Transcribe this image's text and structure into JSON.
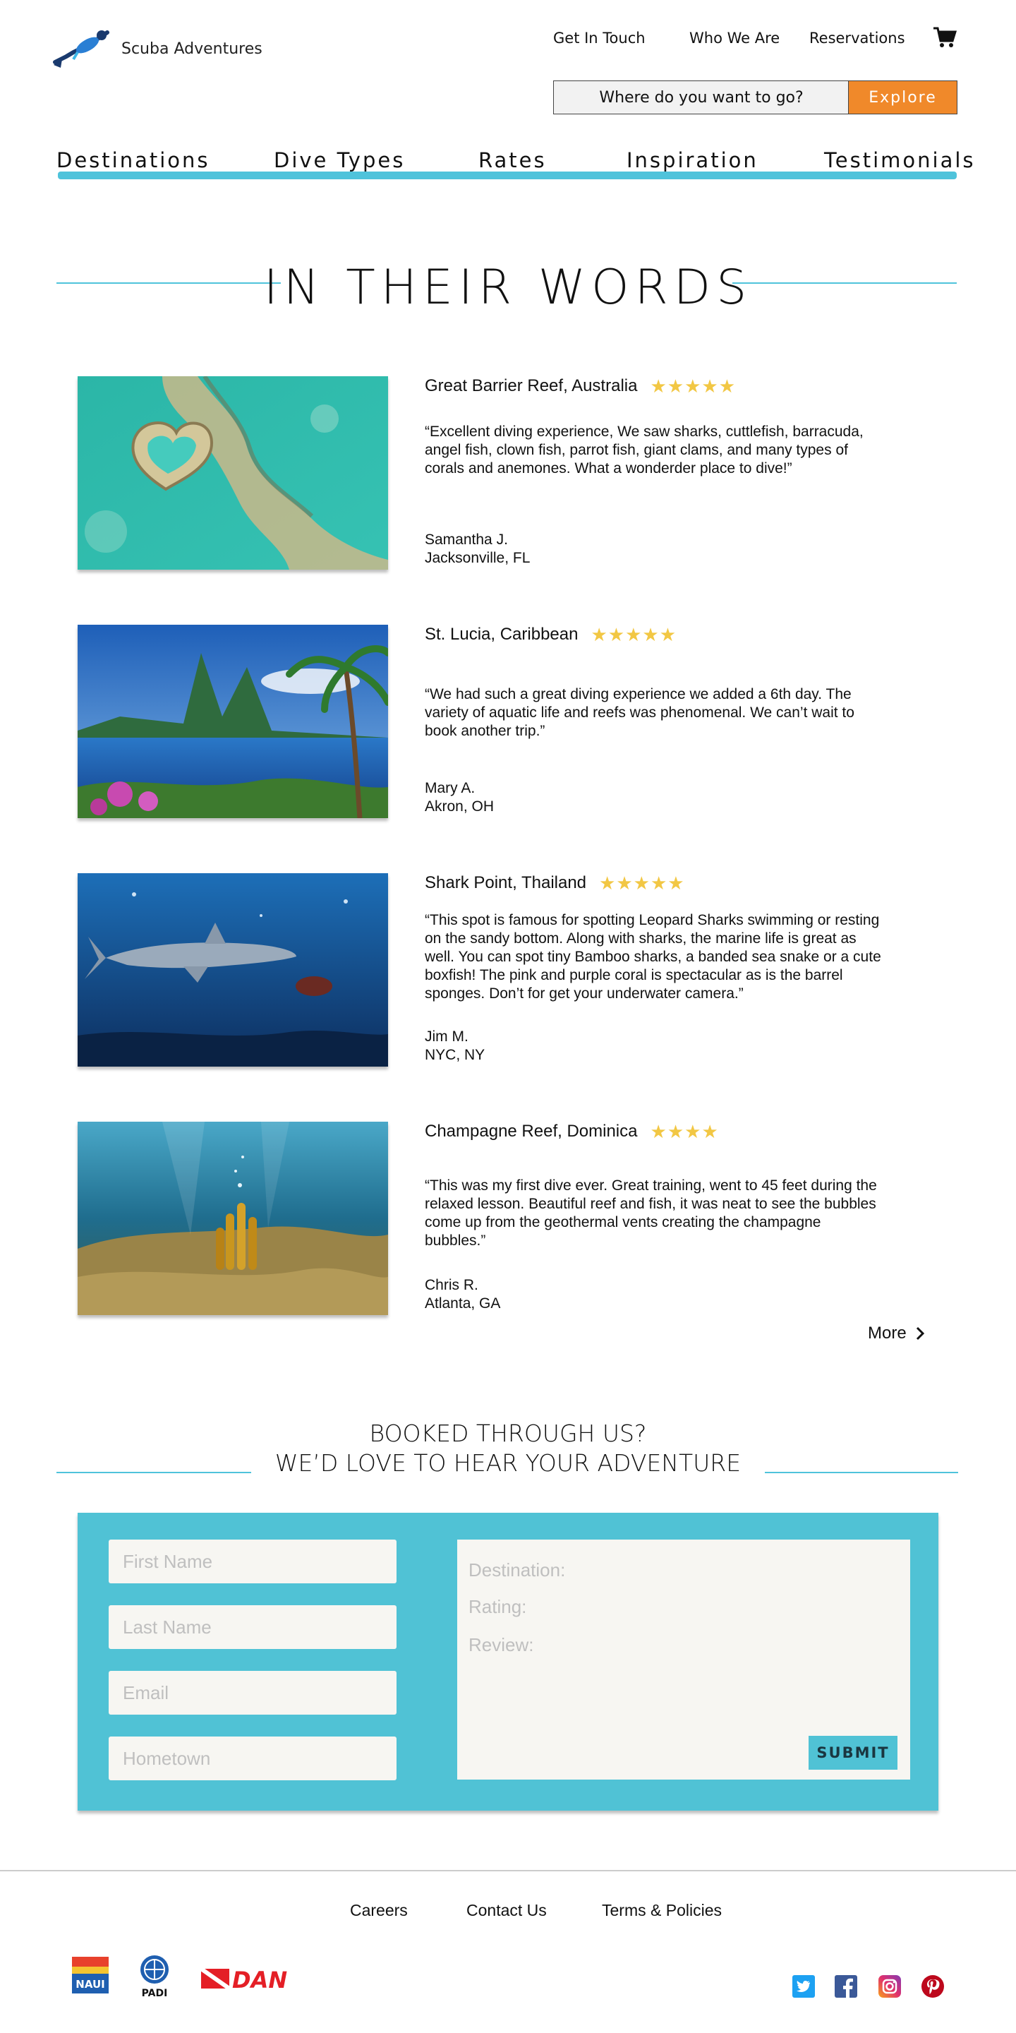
{
  "brand": {
    "name": "Scuba Adventures"
  },
  "topnav": [
    {
      "label": "Get In Touch"
    },
    {
      "label": "Who We Are"
    },
    {
      "label": "Reservations"
    }
  ],
  "search": {
    "placeholder": "Where do you want to go?",
    "button": "Explore"
  },
  "mainnav": [
    {
      "label": "Destinations"
    },
    {
      "label": "Dive Types"
    },
    {
      "label": "Rates"
    },
    {
      "label": "Inspiration"
    },
    {
      "label": "Testimonials"
    }
  ],
  "section_title": "IN THEIR WORDS",
  "testimonials": [
    {
      "title": "Great Barrier Reef, Australia",
      "rating": 5,
      "quote": "“Excellent diving experience, We saw sharks, cuttlefish, barracuda, angel fish, clown fish, parrot fish, giant clams, and many types of corals and anemones. What a wonderder place to dive!”",
      "name": "Samantha J.",
      "location": "Jacksonville, FL"
    },
    {
      "title": "St. Lucia, Caribbean",
      "rating": 5,
      "quote": "“We had such a great diving experience we added a 6th day. The variety of aquatic life and reefs was phenomenal. We can’t wait to book another trip.”",
      "name": "Mary A.",
      "location": "Akron, OH"
    },
    {
      "title": "Shark Point, Thailand",
      "rating": 5,
      "quote": "“This spot is famous for spotting Leopard Sharks swimming or resting on the sandy bottom. Along with sharks, the marine life is great as well. You can spot tiny Bamboo sharks, a banded sea snake or a cute boxfish! The pink and purple coral is spectacular as is the barrel sponges. Don’t for get your underwater camera.”",
      "name": "Jim M.",
      "location": "NYC, NY"
    },
    {
      "title": "Champagne Reef, Dominica",
      "rating": 4,
      "quote": "“This was my first dive ever. Great training, went to 45 feet during the relaxed lesson. Beautiful reef and fish, it was neat to see the bubbles come up from the geothermal vents creating the champagne bubbles.”",
      "name": "Chris R.",
      "location": "Atlanta, GA"
    }
  ],
  "more_label": "More",
  "booked": {
    "line1": "BOOKED THROUGH US?",
    "line2": "WE’D LOVE TO HEAR YOUR ADVENTURE"
  },
  "form": {
    "first_name": "First Name",
    "last_name": "Last Name",
    "email": "Email",
    "hometown": "Hometown",
    "destination": "Destination:",
    "rating": "Rating:",
    "review": "Review:",
    "submit": "SUBMIT"
  },
  "footer": {
    "links": [
      {
        "label": "Careers"
      },
      {
        "label": "Contact Us"
      },
      {
        "label": "Terms & Policies"
      }
    ],
    "partners": {
      "naui": "NAUI",
      "padi": "PADI",
      "dan": "DAN"
    }
  },
  "colors": {
    "accent": "#4fc3db",
    "cta": "#f0892a",
    "star": "#f2c744",
    "form_bg": "#50c2d5"
  },
  "icons": [
    "diver-logo",
    "cart-icon",
    "star-icon",
    "chevron-right-icon",
    "twitter-icon",
    "facebook-icon",
    "instagram-icon",
    "pinterest-icon"
  ]
}
